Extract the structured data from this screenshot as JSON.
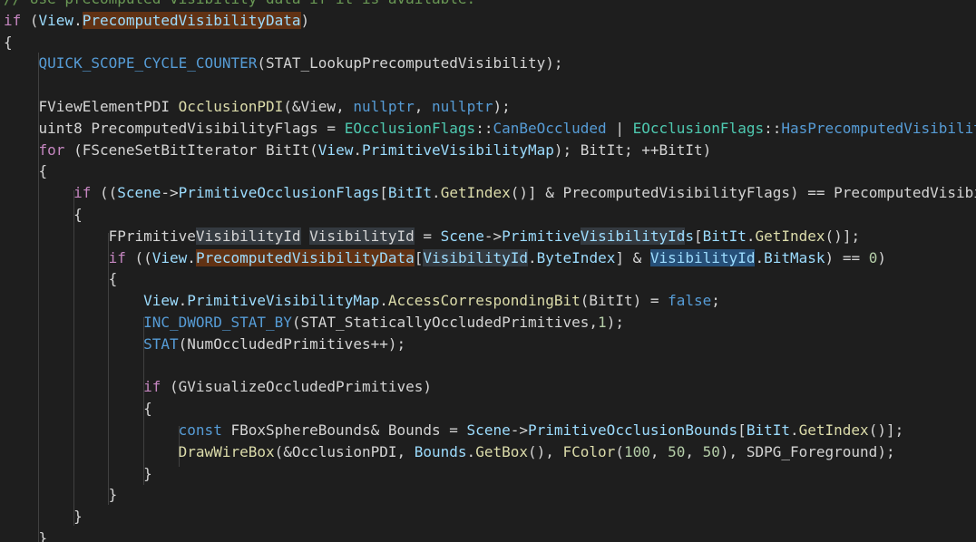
{
  "editor": {
    "colors": {
      "background": "#1e1e1e",
      "keyword": "#569cd6",
      "control": "#c586c0",
      "comment": "#6a9955",
      "variable": "#9cdcfe",
      "type": "#4ec9b0",
      "function": "#dcdcaa",
      "number": "#b5cea8",
      "plain": "#d4d4d4",
      "highlight_orange": "#613214",
      "highlight_reference": "#343a40",
      "highlight_selection": "#264f78"
    },
    "lines": [
      {
        "indent": "",
        "tokens": [
          {
            "t": "// Use precomputed visibility data if it is available.",
            "c": "cmt"
          }
        ]
      },
      {
        "indent": "",
        "tokens": [
          {
            "t": "if",
            "c": "ctl"
          },
          {
            "t": " (",
            "c": "txt"
          },
          {
            "t": "View",
            "c": "var"
          },
          {
            "t": ".",
            "c": "txt"
          },
          {
            "t": "PrecomputedVisibilityData",
            "c": "var",
            "h": "hl-orange"
          },
          {
            "t": ")",
            "c": "txt"
          }
        ]
      },
      {
        "indent": "",
        "tokens": [
          {
            "t": "{",
            "c": "txt"
          }
        ]
      },
      {
        "indent": "    ",
        "tokens": [
          {
            "t": "QUICK_SCOPE_CYCLE_COUNTER",
            "c": "mac"
          },
          {
            "t": "(STAT_LookupPrecomputedVisibility);",
            "c": "txt"
          }
        ]
      },
      {
        "indent": "",
        "tokens": []
      },
      {
        "indent": "    ",
        "tokens": [
          {
            "t": "FViewElementPDI",
            "c": "txt"
          },
          {
            "t": " ",
            "c": "txt"
          },
          {
            "t": "OcclusionPDI",
            "c": "fn"
          },
          {
            "t": "(&View, ",
            "c": "txt"
          },
          {
            "t": "nullptr",
            "c": "kw"
          },
          {
            "t": ", ",
            "c": "txt"
          },
          {
            "t": "nullptr",
            "c": "kw"
          },
          {
            "t": ");",
            "c": "txt"
          }
        ]
      },
      {
        "indent": "    ",
        "tokens": [
          {
            "t": "uint8",
            "c": "txt"
          },
          {
            "t": " PrecomputedVisibilityFlags = ",
            "c": "txt"
          },
          {
            "t": "EOcclusionFlags",
            "c": "ty"
          },
          {
            "t": "::",
            "c": "txt"
          },
          {
            "t": "CanBeOccluded",
            "c": "kw"
          },
          {
            "t": " | ",
            "c": "txt"
          },
          {
            "t": "EOcclusionFlags",
            "c": "ty"
          },
          {
            "t": "::",
            "c": "txt"
          },
          {
            "t": "HasPrecomputedVisibility;",
            "c": "kw"
          }
        ]
      },
      {
        "indent": "    ",
        "tokens": [
          {
            "t": "for",
            "c": "ctl"
          },
          {
            "t": " (FSceneSetBitIterator BitIt(",
            "c": "txt"
          },
          {
            "t": "View",
            "c": "var"
          },
          {
            "t": ".",
            "c": "txt"
          },
          {
            "t": "PrimitiveVisibilityMap",
            "c": "var"
          },
          {
            "t": "); BitIt; ++BitIt)",
            "c": "txt"
          }
        ]
      },
      {
        "indent": "    ",
        "tokens": [
          {
            "t": "{",
            "c": "txt"
          }
        ]
      },
      {
        "indent": "        ",
        "tokens": [
          {
            "t": "if",
            "c": "ctl"
          },
          {
            "t": " ((",
            "c": "txt"
          },
          {
            "t": "Scene",
            "c": "var"
          },
          {
            "t": "->",
            "c": "txt"
          },
          {
            "t": "PrimitiveOcclusionFlags",
            "c": "var"
          },
          {
            "t": "[",
            "c": "txt"
          },
          {
            "t": "BitIt",
            "c": "var"
          },
          {
            "t": ".",
            "c": "txt"
          },
          {
            "t": "GetIndex",
            "c": "fn"
          },
          {
            "t": "()] & PrecomputedVisibilityFlags) == PrecomputedVisibilityFlags)",
            "c": "txt"
          }
        ]
      },
      {
        "indent": "        ",
        "tokens": [
          {
            "t": "{",
            "c": "txt"
          }
        ]
      },
      {
        "indent": "            ",
        "tokens": [
          {
            "t": "FPrimitive",
            "c": "txt"
          },
          {
            "t": "VisibilityId",
            "c": "txt",
            "h": "hl-ref"
          },
          {
            "t": " ",
            "c": "txt"
          },
          {
            "t": "VisibilityId",
            "c": "txt",
            "h": "hl-ref"
          },
          {
            "t": " = ",
            "c": "txt"
          },
          {
            "t": "Scene",
            "c": "var"
          },
          {
            "t": "->",
            "c": "txt"
          },
          {
            "t": "Primitive",
            "c": "var"
          },
          {
            "t": "VisibilityId",
            "c": "var",
            "h": "hl-ref"
          },
          {
            "t": "s",
            "c": "var"
          },
          {
            "t": "[",
            "c": "txt"
          },
          {
            "t": "BitIt",
            "c": "var"
          },
          {
            "t": ".",
            "c": "txt"
          },
          {
            "t": "GetIndex",
            "c": "fn"
          },
          {
            "t": "()];",
            "c": "txt"
          }
        ]
      },
      {
        "indent": "            ",
        "tokens": [
          {
            "t": "if",
            "c": "ctl"
          },
          {
            "t": " ((",
            "c": "txt"
          },
          {
            "t": "View",
            "c": "var"
          },
          {
            "t": ".",
            "c": "txt"
          },
          {
            "t": "PrecomputedVisibilityData",
            "c": "var",
            "h": "hl-orange"
          },
          {
            "t": "[",
            "c": "txt"
          },
          {
            "t": "VisibilityId",
            "c": "var",
            "h": "hl-ref"
          },
          {
            "t": ".",
            "c": "txt"
          },
          {
            "t": "ByteIndex",
            "c": "var"
          },
          {
            "t": "] & ",
            "c": "txt"
          },
          {
            "t": "VisibilityId",
            "c": "var",
            "h": "hl-sel"
          },
          {
            "t": ".",
            "c": "txt"
          },
          {
            "t": "BitMask",
            "c": "var"
          },
          {
            "t": ") == ",
            "c": "txt"
          },
          {
            "t": "0",
            "c": "num"
          },
          {
            "t": ")",
            "c": "txt"
          }
        ]
      },
      {
        "indent": "            ",
        "tokens": [
          {
            "t": "{",
            "c": "txt"
          }
        ]
      },
      {
        "indent": "                ",
        "tokens": [
          {
            "t": "View",
            "c": "var"
          },
          {
            "t": ".",
            "c": "txt"
          },
          {
            "t": "PrimitiveVisibilityMap",
            "c": "var"
          },
          {
            "t": ".",
            "c": "txt"
          },
          {
            "t": "AccessCorrespondingBit",
            "c": "fn"
          },
          {
            "t": "(BitIt) = ",
            "c": "txt"
          },
          {
            "t": "false",
            "c": "kw"
          },
          {
            "t": ";",
            "c": "txt"
          }
        ]
      },
      {
        "indent": "                ",
        "tokens": [
          {
            "t": "INC_DWORD_STAT_BY",
            "c": "mac"
          },
          {
            "t": "(STAT_StaticallyOccludedPrimitives,",
            "c": "txt"
          },
          {
            "t": "1",
            "c": "num"
          },
          {
            "t": ");",
            "c": "txt"
          }
        ]
      },
      {
        "indent": "                ",
        "tokens": [
          {
            "t": "STAT",
            "c": "mac"
          },
          {
            "t": "(NumOccludedPrimitives++);",
            "c": "txt"
          }
        ]
      },
      {
        "indent": "",
        "tokens": []
      },
      {
        "indent": "                ",
        "tokens": [
          {
            "t": "if",
            "c": "ctl"
          },
          {
            "t": " (GVisualizeOccludedPrimitives)",
            "c": "txt"
          }
        ]
      },
      {
        "indent": "                ",
        "tokens": [
          {
            "t": "{",
            "c": "txt"
          }
        ]
      },
      {
        "indent": "                    ",
        "tokens": [
          {
            "t": "const",
            "c": "kw"
          },
          {
            "t": " FBoxSphereBounds& Bounds = ",
            "c": "txt"
          },
          {
            "t": "Scene",
            "c": "var"
          },
          {
            "t": "->",
            "c": "txt"
          },
          {
            "t": "PrimitiveOcclusionBounds",
            "c": "var"
          },
          {
            "t": "[",
            "c": "txt"
          },
          {
            "t": "BitIt",
            "c": "var"
          },
          {
            "t": ".",
            "c": "txt"
          },
          {
            "t": "GetIndex",
            "c": "fn"
          },
          {
            "t": "()];",
            "c": "txt"
          }
        ]
      },
      {
        "indent": "                    ",
        "tokens": [
          {
            "t": "DrawWireBox",
            "c": "fn"
          },
          {
            "t": "(&OcclusionPDI, ",
            "c": "txt"
          },
          {
            "t": "Bounds",
            "c": "var"
          },
          {
            "t": ".",
            "c": "txt"
          },
          {
            "t": "GetBox",
            "c": "fn"
          },
          {
            "t": "(), ",
            "c": "txt"
          },
          {
            "t": "FColor",
            "c": "fn"
          },
          {
            "t": "(",
            "c": "txt"
          },
          {
            "t": "100",
            "c": "num"
          },
          {
            "t": ", ",
            "c": "txt"
          },
          {
            "t": "50",
            "c": "num"
          },
          {
            "t": ", ",
            "c": "txt"
          },
          {
            "t": "50",
            "c": "num"
          },
          {
            "t": "), SDPG_Foreground);",
            "c": "txt"
          }
        ]
      },
      {
        "indent": "                ",
        "tokens": [
          {
            "t": "}",
            "c": "txt"
          }
        ]
      },
      {
        "indent": "            ",
        "tokens": [
          {
            "t": "}",
            "c": "txt"
          }
        ]
      },
      {
        "indent": "        ",
        "tokens": [
          {
            "t": "}",
            "c": "txt"
          }
        ]
      },
      {
        "indent": "    ",
        "tokens": [
          {
            "t": "}",
            "c": "txt"
          }
        ]
      }
    ]
  }
}
